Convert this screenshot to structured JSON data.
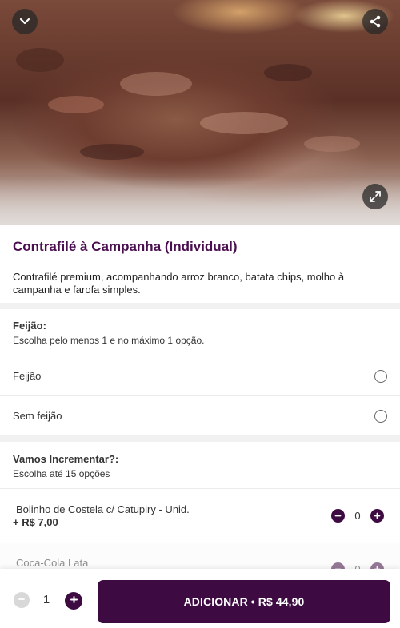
{
  "product": {
    "title": "Contrafilé à Campanha (Individual)",
    "description": "Contrafilé premium, acompanhando arroz branco, batata chips, molho à campanha e farofa simples."
  },
  "hero_buttons": {
    "collapse_icon": "chevron-down-icon",
    "share_icon": "share-icon",
    "expand_icon": "expand-icon"
  },
  "groups": [
    {
      "title": "Feijão:",
      "subtitle": "Escolha pelo menos 1 e no máximo 1 opção.",
      "options": [
        {
          "label": "Feijão"
        },
        {
          "label": "Sem feijão"
        }
      ]
    },
    {
      "title": "Vamos Incrementar?:",
      "subtitle": "Escolha até 15 opções",
      "items": [
        {
          "name": "Bolinho de Costela c/ Catupiry - Unid.",
          "price": "+ R$ 7,00",
          "count": "0"
        },
        {
          "name": "Coca-Cola Lata",
          "count": "0"
        }
      ]
    }
  ],
  "footer": {
    "quantity": "1",
    "add_label": "ADICIONAR • R$ 44,90"
  },
  "colors": {
    "brand": "#3d0a42",
    "title": "#4a0f4f",
    "divider": "#f1f1f1"
  }
}
